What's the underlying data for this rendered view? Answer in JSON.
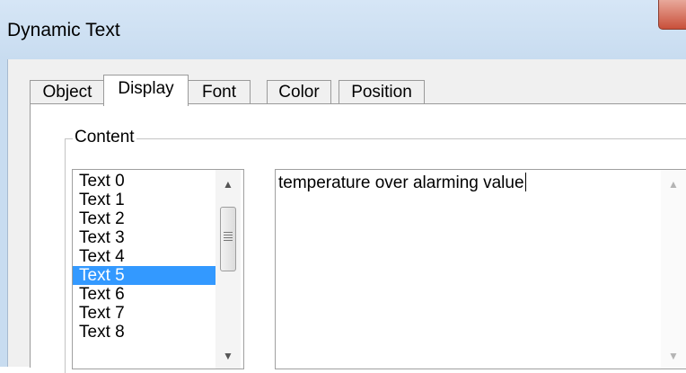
{
  "window": {
    "title": "Dynamic Text"
  },
  "tabs": [
    {
      "label": "Object",
      "active": false
    },
    {
      "label": "Display",
      "active": true
    },
    {
      "label": "Font",
      "active": false
    },
    {
      "label": "Color",
      "active": false
    },
    {
      "label": "Position",
      "active": false
    }
  ],
  "content_group": {
    "label": "Content"
  },
  "text_list": {
    "items": [
      "Text 0",
      "Text 1",
      "Text 2",
      "Text 3",
      "Text 4",
      "Text 5",
      "Text 6",
      "Text 7",
      "Text 8"
    ],
    "selected": "Text 5"
  },
  "text_editor": {
    "value": "temperature over alarming value"
  },
  "scroll_arrows": {
    "up": "▲",
    "down": "▼"
  },
  "colors": {
    "selection": "#3399ff",
    "title_bar": "#d6e6f6",
    "close_button": "#c9503a"
  }
}
